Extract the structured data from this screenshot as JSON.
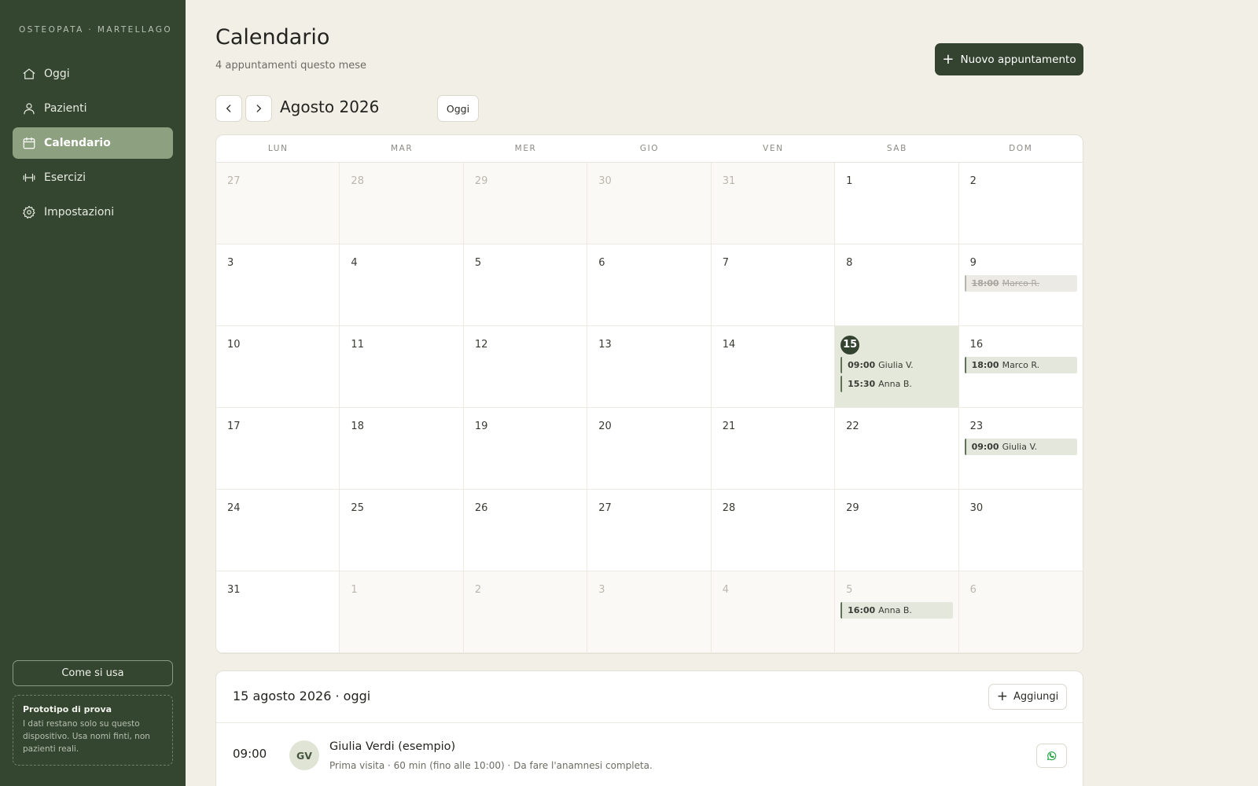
{
  "sidebar": {
    "brand": "OSTEOPATA · MARTELLAGO",
    "items": [
      {
        "label": "Oggi",
        "icon": "home-icon"
      },
      {
        "label": "Pazienti",
        "icon": "user-icon"
      },
      {
        "label": "Calendario",
        "icon": "calendar-icon",
        "active": true
      },
      {
        "label": "Esercizi",
        "icon": "dumbbell-icon"
      },
      {
        "label": "Impostazioni",
        "icon": "gear-icon"
      }
    ],
    "help_label": "Come si usa",
    "prototype": {
      "title": "Prototipo di prova",
      "text": "I dati restano solo su questo dispositivo. Usa nomi finti, non pazienti reali."
    }
  },
  "header": {
    "title": "Calendario",
    "subtitle": "4 appuntamenti questo mese",
    "new_button": "Nuovo appuntamento"
  },
  "month_nav": {
    "label": "Agosto 2026",
    "today_button": "Oggi"
  },
  "calendar": {
    "weekdays": [
      "LUN",
      "MAR",
      "MER",
      "GIO",
      "VEN",
      "SAB",
      "DOM"
    ],
    "days": [
      {
        "n": "27",
        "other": true
      },
      {
        "n": "28",
        "other": true
      },
      {
        "n": "29",
        "other": true
      },
      {
        "n": "30",
        "other": true
      },
      {
        "n": "31",
        "other": true
      },
      {
        "n": "1"
      },
      {
        "n": "2"
      },
      {
        "n": "3"
      },
      {
        "n": "4"
      },
      {
        "n": "5"
      },
      {
        "n": "6"
      },
      {
        "n": "7"
      },
      {
        "n": "8"
      },
      {
        "n": "9",
        "appts": [
          {
            "time": "18:00",
            "name": "Marco R.",
            "cancelled": true
          }
        ]
      },
      {
        "n": "10"
      },
      {
        "n": "11"
      },
      {
        "n": "12"
      },
      {
        "n": "13"
      },
      {
        "n": "14"
      },
      {
        "n": "15",
        "today": true,
        "appts": [
          {
            "time": "09:00",
            "name": "Giulia V."
          },
          {
            "time": "15:30",
            "name": "Anna B."
          }
        ]
      },
      {
        "n": "16",
        "appts": [
          {
            "time": "18:00",
            "name": "Marco R."
          }
        ]
      },
      {
        "n": "17"
      },
      {
        "n": "18"
      },
      {
        "n": "19"
      },
      {
        "n": "20"
      },
      {
        "n": "21"
      },
      {
        "n": "22"
      },
      {
        "n": "23",
        "appts": [
          {
            "time": "09:00",
            "name": "Giulia V."
          }
        ]
      },
      {
        "n": "24"
      },
      {
        "n": "25"
      },
      {
        "n": "26"
      },
      {
        "n": "27"
      },
      {
        "n": "28"
      },
      {
        "n": "29"
      },
      {
        "n": "30"
      },
      {
        "n": "31"
      },
      {
        "n": "1",
        "other": true
      },
      {
        "n": "2",
        "other": true
      },
      {
        "n": "3",
        "other": true
      },
      {
        "n": "4",
        "other": true
      },
      {
        "n": "5",
        "other": true,
        "appts": [
          {
            "time": "16:00",
            "name": "Anna B."
          }
        ]
      },
      {
        "n": "6",
        "other": true
      }
    ]
  },
  "day_panel": {
    "title": "15 agosto 2026 · oggi",
    "add_button": "Aggiungi",
    "appointments": [
      {
        "time": "09:00",
        "initials": "GV",
        "name": "Giulia Verdi (esempio)",
        "detail": "Prima visita · 60 min (fino alle 10:00) · Da fare l'anamnesi completa."
      }
    ]
  },
  "colors": {
    "sidebar_bg": "#344530",
    "accent": "#33432f",
    "active_nav": "#8da07f",
    "today_cell": "#e3e8da",
    "whatsapp": "#25a244"
  }
}
